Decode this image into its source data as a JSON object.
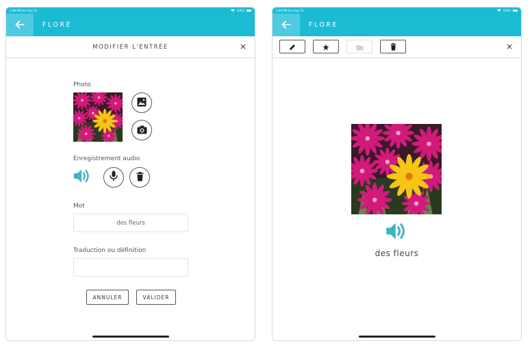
{
  "colors": {
    "accent": "#1cbbd4",
    "accent_light": "#4dcbe0",
    "speaker": "#3fb3c2"
  },
  "status_bar": {
    "time_date": "5:08 PM  Sun Sep 15",
    "battery": "100%"
  },
  "nav": {
    "back_icon": "arrow-left-icon",
    "title": "FLORE"
  },
  "edit_screen": {
    "header_title": "MODIFIER L'ENTRÉE",
    "close_label": "×",
    "photo_label": "Photo",
    "audio_label": "Enregistrement audio",
    "word_label": "Mot",
    "word_value": "des fleurs",
    "translation_label": "Traduction ou définition",
    "translation_value": "",
    "cancel_label": "ANNULER",
    "validate_label": "VALIDER",
    "icons": [
      "gallery-icon",
      "camera-icon",
      "speaker-icon",
      "microphone-icon",
      "trash-icon"
    ]
  },
  "view_screen": {
    "toolbar_icons": [
      "pencil-icon",
      "star-icon",
      "folder-icon",
      "trash-icon"
    ],
    "close_label": "×",
    "word": "des fleurs"
  }
}
